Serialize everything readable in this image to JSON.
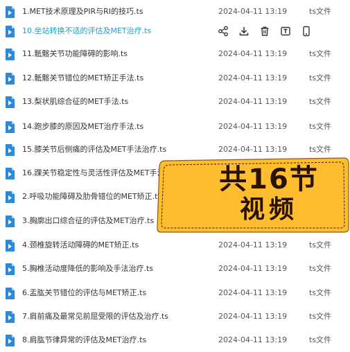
{
  "files": [
    {
      "name": "1.MET技术原理及PIR与RI的技巧.ts",
      "date": "2024-04-11 13:19",
      "type": "ts文件"
    },
    {
      "name": "10.坐站转换不适的评估及MET治疗.ts",
      "date": "",
      "type": "",
      "hovered": true
    },
    {
      "name": "11.骶髂关节功能障碍的影响.ts",
      "date": "2024-04-11 13:19",
      "type": "ts文件"
    },
    {
      "name": "12.骶髂关节错位的MET矫正手法.ts",
      "date": "2024-04-11 13:19",
      "type": "ts文件"
    },
    {
      "name": "13.梨状肌综合征的MET手法.ts",
      "date": "2024-04-11 13:19",
      "type": "ts文件"
    },
    {
      "name": "14.跑步膝的原因及MET治疗手法.ts",
      "date": "2024-04-11 13:19",
      "type": "ts文件"
    },
    {
      "name": "15.膝关节后侧痛的评估及MET手法治疗.ts",
      "date": "2024-04-11 13:19",
      "type": "ts文件"
    },
    {
      "name": "16.踝关节稳定性与灵活性评估及MET手法",
      "date": "",
      "type": ""
    },
    {
      "name": "2.呼吸功能障碍及肋骨错位的MET矫正.ts",
      "date": "",
      "type": ""
    },
    {
      "name": "3.胸廓出口综合征的评估及MET治疗.ts",
      "date": "",
      "type": ""
    },
    {
      "name": "4.颈椎旋转活动障碍的MET矫正.ts",
      "date": "2024-04-11 13:19",
      "type": "ts文件"
    },
    {
      "name": "5.胸椎活动度降低的影响及手法治疗.ts",
      "date": "2024-04-11 13:19",
      "type": "ts文件"
    },
    {
      "name": "6.盂肱关节错位的评估与MET矫正.ts",
      "date": "2024-04-11 13:19",
      "type": "ts文件"
    },
    {
      "name": "7.肩前痛及最常见前屈受限的评估及治疗.ts",
      "date": "2024-04-11 13:19",
      "type": "ts文件"
    },
    {
      "name": "8.肩肱节律异常的评估及MET治疗.ts",
      "date": "2024-04-11 13:19",
      "type": "ts文件"
    }
  ],
  "hover_actions": [
    "share-icon",
    "download-icon",
    "delete-icon",
    "rename-icon",
    "open-on-phone-icon"
  ],
  "colors": {
    "file_icon": "#2e8ad8",
    "highlight_text": "#1aa0c7",
    "promo_fill": "#fdbd2f",
    "promo_text": "#2a1200"
  },
  "promo": {
    "line1": "共16节",
    "line2": "视频"
  }
}
